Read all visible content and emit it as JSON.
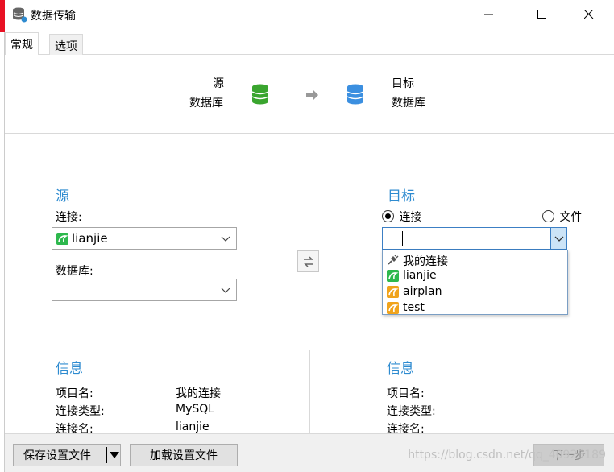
{
  "window": {
    "title": "数据传输"
  },
  "tabs": [
    {
      "label": "常规",
      "active": true
    },
    {
      "label": "选项",
      "active": false
    }
  ],
  "header": {
    "source_line1": "源",
    "source_line2": "数据库",
    "target_line1": "目标",
    "target_line2": "数据库"
  },
  "source": {
    "title": "源",
    "connection_label": "连接:",
    "connection_value": "lianjie",
    "database_label": "数据库:",
    "database_value": ""
  },
  "target": {
    "title": "目标",
    "radio_connection": "连接",
    "radio_file": "文件",
    "selected_radio": "connection",
    "combo_value": "",
    "dropdown_items": [
      {
        "label": "我的连接",
        "icon": "plug-icon",
        "color": "#555555"
      },
      {
        "label": "lianjie",
        "icon": "mysql-icon",
        "color": "#2db84d"
      },
      {
        "label": "airplan",
        "icon": "mysql-icon",
        "color": "#f0a31b"
      },
      {
        "label": "test",
        "icon": "mysql-icon",
        "color": "#f0a31b"
      }
    ]
  },
  "info_left": {
    "title": "信息",
    "rows": [
      {
        "key": "项目名:",
        "value": "我的连接"
      },
      {
        "key": "连接类型:",
        "value": "MySQL"
      },
      {
        "key": "连接名:",
        "value": "lianjie"
      }
    ]
  },
  "info_right": {
    "title": "信息",
    "rows": [
      {
        "key": "项目名:",
        "value": ""
      },
      {
        "key": "连接类型:",
        "value": ""
      },
      {
        "key": "连接名:",
        "value": ""
      }
    ]
  },
  "footer": {
    "save_label": "保存设置文件",
    "load_label": "加载设置文件",
    "next_label": "下一步",
    "watermark": "https://blog.csdn.net/qq_40925189"
  },
  "colors": {
    "accent": "#2e8bd0",
    "source_db": "#3aa52f",
    "target_db": "#3b8fe0"
  }
}
